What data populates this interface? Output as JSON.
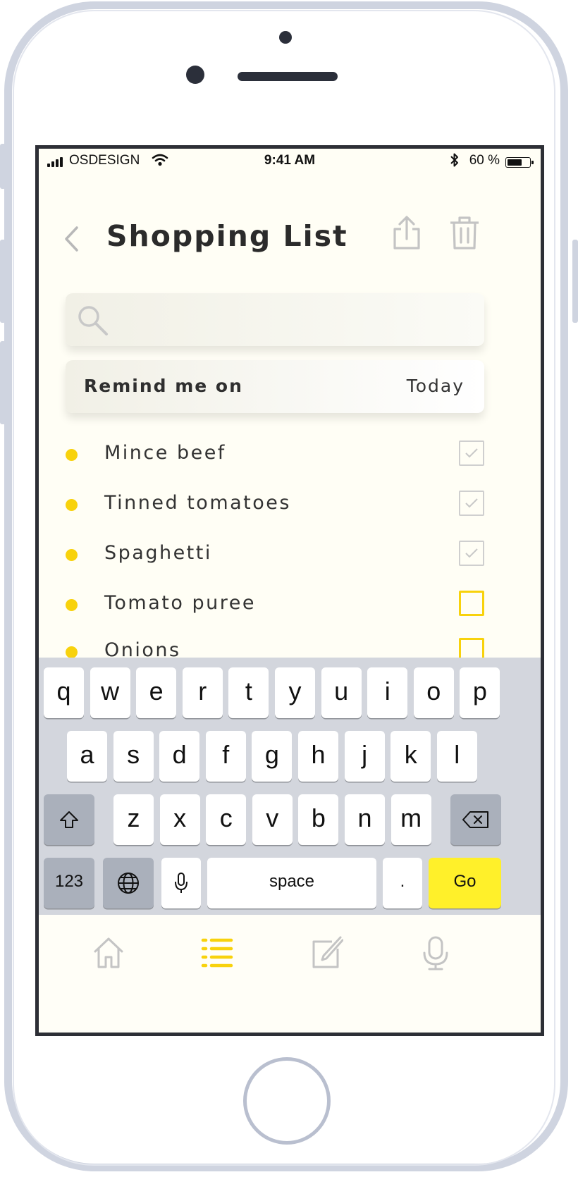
{
  "status_bar": {
    "carrier": "OSDESIGN",
    "time": "9:41 AM",
    "battery": "60 %"
  },
  "header": {
    "title": "Shopping List"
  },
  "search": {
    "placeholder": "",
    "value": ""
  },
  "reminder": {
    "label": "Remind me on",
    "value": "Today"
  },
  "items": [
    {
      "label": "Mince beef",
      "checked": true
    },
    {
      "label": "Tinned tomatoes",
      "checked": true
    },
    {
      "label": "Spaghetti",
      "checked": true
    },
    {
      "label": "Tomato puree",
      "checked": false
    },
    {
      "label": "Onions",
      "checked": false
    }
  ],
  "keyboard": {
    "row1": [
      "q",
      "w",
      "e",
      "r",
      "t",
      "y",
      "u",
      "i",
      "o",
      "p"
    ],
    "row2": [
      "a",
      "s",
      "d",
      "f",
      "g",
      "h",
      "j",
      "k",
      "l"
    ],
    "row3": [
      "z",
      "x",
      "c",
      "v",
      "b",
      "n",
      "m"
    ],
    "numbers_label": "123",
    "space_label": "space",
    "period_label": ".",
    "go_label": "Go"
  },
  "tabbar": {
    "tabs": [
      "home-icon",
      "list-icon",
      "edit-icon",
      "microphone-icon"
    ],
    "active": "list-icon"
  },
  "colors": {
    "accent": "#f8d20c",
    "go_key": "#fff02a",
    "screen_bg": "#fffef5"
  }
}
